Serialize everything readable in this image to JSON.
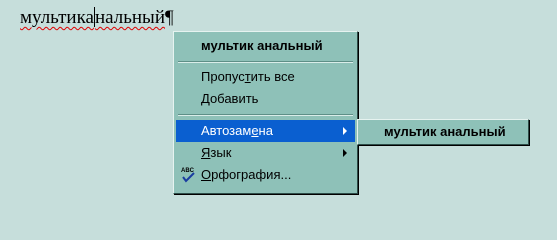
{
  "document": {
    "text_before_caret": "мультика",
    "text_after_caret": "нальный",
    "paragraph_mark": "¶"
  },
  "context_menu": {
    "suggestion": "мультик анальный",
    "items": [
      {
        "label_pre": "Пропус",
        "access_key": "т",
        "label_post": "ить все",
        "has_submenu": false
      },
      {
        "label_pre": "",
        "access_key": "Д",
        "label_post": "обавить",
        "has_submenu": false
      },
      {
        "label_pre": "Автозам",
        "access_key": "е",
        "label_post": "на",
        "has_submenu": true,
        "highlighted": true
      },
      {
        "label_pre": "",
        "access_key": "Я",
        "label_post": "зык",
        "has_submenu": true
      },
      {
        "label_pre": "",
        "access_key": "О",
        "label_post": "рфография...",
        "has_submenu": false,
        "icon": "spell-check-icon"
      }
    ]
  },
  "autocorrect_submenu": {
    "items": [
      {
        "label": "мультик анальный"
      }
    ]
  },
  "colors": {
    "background": "#c6dedb",
    "menu_background": "#8ec1b8",
    "highlight": "#0a5fd0",
    "spelling_underline": "#e00000"
  }
}
